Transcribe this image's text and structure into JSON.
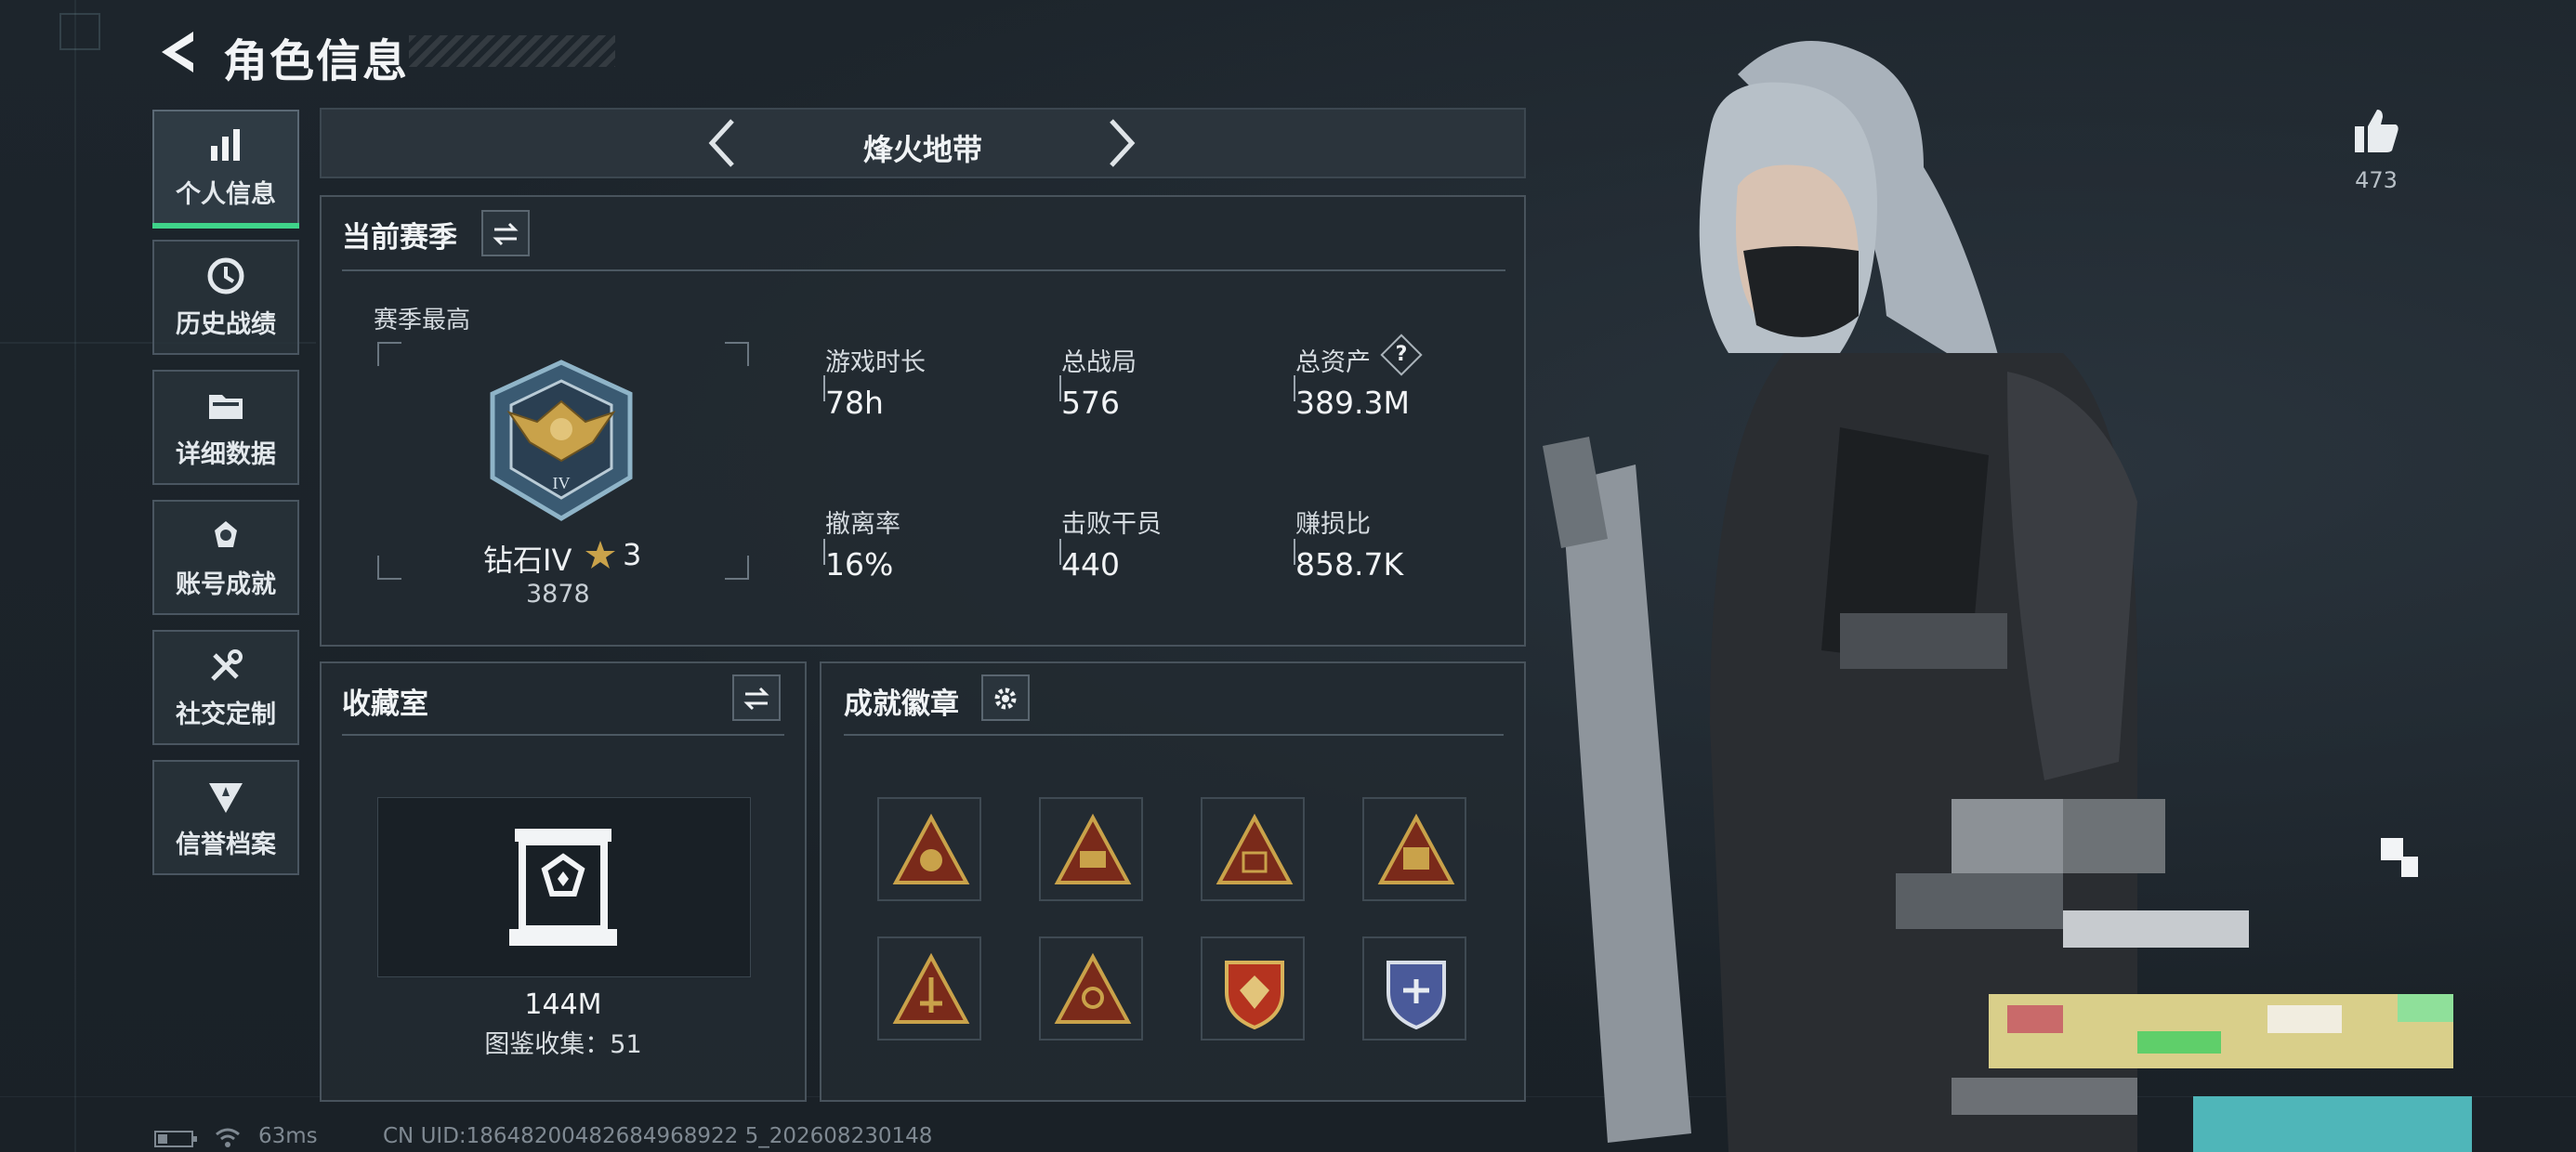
{
  "header": {
    "title": "角色信息"
  },
  "sidebar": {
    "items": [
      {
        "label": "个人信息",
        "icon": "bar-chart-icon",
        "active": true
      },
      {
        "label": "历史战绩",
        "icon": "history-clock-icon",
        "active": false
      },
      {
        "label": "详细数据",
        "icon": "folder-icon",
        "active": false
      },
      {
        "label": "账号成就",
        "icon": "achievement-icon",
        "active": false
      },
      {
        "label": "社交定制",
        "icon": "tools-icon",
        "active": false
      },
      {
        "label": "信誉档案",
        "icon": "credit-shield-icon",
        "active": false
      }
    ]
  },
  "mode": {
    "label": "烽火地带"
  },
  "season": {
    "title": "当前赛季",
    "best_label": "赛季最高",
    "rank_name": "钻石IV",
    "rank_stars": "3",
    "rank_points": "3878",
    "stats": [
      {
        "label": "游戏时长",
        "value": "78h"
      },
      {
        "label": "总战局",
        "value": "576"
      },
      {
        "label": "总资产",
        "value": "389.3M",
        "help": "?"
      },
      {
        "label": "撤离率",
        "value": "16%"
      },
      {
        "label": "击败干员",
        "value": "440"
      },
      {
        "label": "赚损比",
        "value": "858.7K"
      }
    ]
  },
  "collection": {
    "title": "收藏室",
    "value": "144M",
    "catalog": "图鉴收集：51"
  },
  "achievements": {
    "title": "成就徽章",
    "badge_count": 8
  },
  "likes": {
    "count": "473"
  },
  "status": {
    "ping": "63ms",
    "uid": "CN UID:18648200482684968922 5_202608230148"
  },
  "colors": {
    "accent_active": "#3fd38a",
    "gold": "#c9a24a",
    "panel_border": "#48535c"
  }
}
